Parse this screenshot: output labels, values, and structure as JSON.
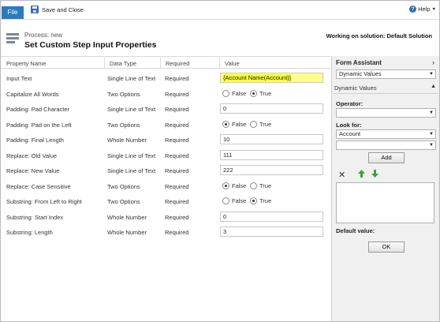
{
  "ribbon": {
    "file_label": "File",
    "save_close_label": "Save and Close",
    "help_label": "Help"
  },
  "header": {
    "subtitle": "Process: new",
    "title": "Set Custom Step Input Properties",
    "solution": "Working on solution: Default Solution"
  },
  "table": {
    "columns": [
      "Property Name",
      "Data Type",
      "Required",
      "Value"
    ],
    "rows": [
      {
        "name": "Input Text",
        "type": "Single Line of Text",
        "required": "Required",
        "value": "{Account Name(Account)}"
      },
      {
        "name": "Capitalize All Words",
        "type": "Two Options",
        "required": "Required",
        "false_label": "False",
        "true_label": "True",
        "selected": "True"
      },
      {
        "name": "Padding: Pad Character",
        "type": "Single Line of Text",
        "required": "Required",
        "value": "0"
      },
      {
        "name": "Padding: Pad on the Left",
        "type": "Two Options",
        "required": "Required",
        "false_label": "False",
        "true_label": "True",
        "selected": "False"
      },
      {
        "name": "Padding: Final Length",
        "type": "Whole Number",
        "required": "Required",
        "value": "10"
      },
      {
        "name": "Replace: Old Value",
        "type": "Single Line of Text",
        "required": "Required",
        "value": "111"
      },
      {
        "name": "Replace: New Value",
        "type": "Single Line of Text",
        "required": "Required",
        "value": "222"
      },
      {
        "name": "Replace: Case Sensitive",
        "type": "Two Options",
        "required": "Required",
        "false_label": "False",
        "true_label": "True",
        "selected": "False"
      },
      {
        "name": "Substring: From Left to Right",
        "type": "Two Options",
        "required": "Required",
        "false_label": "False",
        "true_label": "True",
        "selected": "True"
      },
      {
        "name": "Substring: Start Index",
        "type": "Whole Number",
        "required": "Required",
        "value": "0"
      },
      {
        "name": "Substring: Length",
        "type": "Whole Number",
        "required": "Required",
        "value": "3"
      }
    ]
  },
  "assistant": {
    "title": "Form Assistant",
    "mode_select": "Dynamic Values",
    "section_title": "Dynamic Values",
    "operator_label": "Operator:",
    "operator_value": "",
    "look_for_label": "Look for:",
    "look_for_value": "Account",
    "look_for_attr_value": "",
    "add_label": "Add",
    "default_value_label": "Default value:",
    "ok_label": "OK"
  },
  "colors": {
    "accent": "#2b79c2",
    "highlight": "#fbfb33",
    "arrow_green": "#3aa23a"
  }
}
